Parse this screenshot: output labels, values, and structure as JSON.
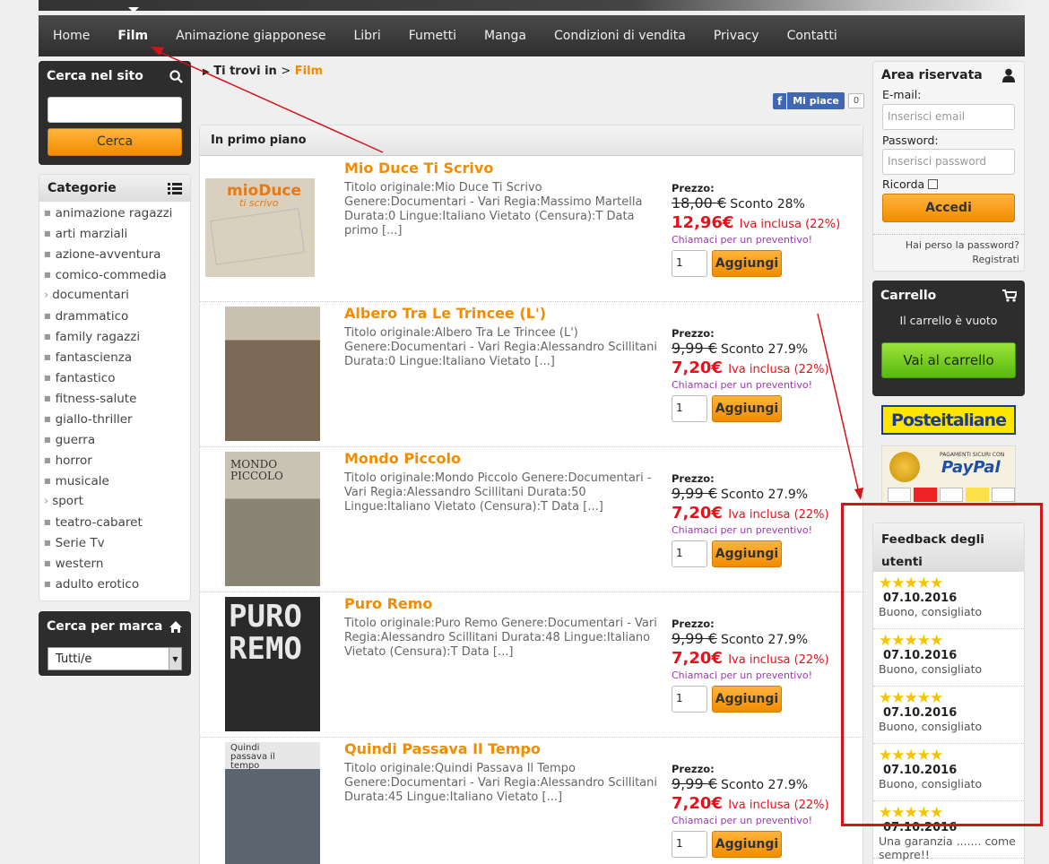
{
  "nav": [
    "Home",
    "Film",
    "Animazione giapponese",
    "Libri",
    "Fumetti",
    "Manga",
    "Condizioni di vendita",
    "Privacy",
    "Contatti"
  ],
  "search": {
    "title": "Cerca nel sito",
    "button": "Cerca"
  },
  "categories": {
    "title": "Categorie",
    "items": [
      "animazione ragazzi",
      "arti marziali",
      "azione-avventura",
      "comico-commedia",
      "documentari",
      "drammatico",
      "family ragazzi",
      "fantascienza",
      "fantastico",
      "fitness-salute",
      "giallo-thriller",
      "guerra",
      "horror",
      "musicale",
      "sport",
      "teatro-cabaret",
      "Serie Tv",
      "western",
      "adulto erotico"
    ]
  },
  "brand": {
    "title": "Cerca per marca",
    "selected": "Tutti/e"
  },
  "breadcrumb": {
    "prefix": "Ti trovi in",
    "sep": ">",
    "current": "Film"
  },
  "facebook": {
    "like": "Mi piace",
    "count": "0"
  },
  "featured_title": "In primo piano",
  "products": [
    {
      "title": "Mio Duce Ti Scrivo",
      "desc": "Titolo originale:Mio Duce Ti Scrivo Genere:Documentari - Vari Regia:Massimo Martella Durata:0 Lingue:Italiano Vietato (Censura):T Data primo [...]",
      "price_label": "Prezzo:",
      "old": "18,00 €",
      "discount": "Sconto 28%",
      "new": "12,96€",
      "iva": "Iva inclusa (22%)",
      "quote": "Chiamaci per un preventivo!",
      "qty": "1",
      "add": "Aggiungi",
      "cover_color": "#d9d1bd"
    },
    {
      "title": "Albero Tra Le Trincee (L')",
      "desc": "Titolo originale:Albero Tra Le Trincee (L') Genere:Documentari - Vari Regia:Alessandro Scillitani Durata:0 Lingue:Italiano Vietato [...]",
      "price_label": "Prezzo:",
      "old": "9,99 €",
      "discount": "Sconto 27.9%",
      "new": "7,20€",
      "iva": "Iva inclusa (22%)",
      "quote": "Chiamaci per un preventivo!",
      "qty": "1",
      "add": "Aggiungi",
      "cover_color": "#7a6a55"
    },
    {
      "title": "Mondo Piccolo",
      "desc": "Titolo originale:Mondo Piccolo Genere:Documentari - Vari Regia:Alessandro Scillitani Durata:50 Lingue:Italiano Vietato (Censura):T Data [...]",
      "price_label": "Prezzo:",
      "old": "9,99 €",
      "discount": "Sconto 27.9%",
      "new": "7,20€",
      "iva": "Iva inclusa (22%)",
      "quote": "Chiamaci per un preventivo!",
      "qty": "1",
      "add": "Aggiungi",
      "cover_color": "#c9c3b3"
    },
    {
      "title": "Puro Remo",
      "desc": "Titolo originale:Puro Remo Genere:Documentari - Vari Regia:Alessandro Scillitani Durata:48 Lingue:Italiano Vietato (Censura):T Data [...]",
      "price_label": "Prezzo:",
      "old": "9,99 €",
      "discount": "Sconto 27.9%",
      "new": "7,20€",
      "iva": "Iva inclusa (22%)",
      "quote": "Chiamaci per un preventivo!",
      "qty": "1",
      "add": "Aggiungi",
      "cover_color": "#2a2a2a"
    },
    {
      "title": "Quindi Passava Il Tempo",
      "desc": "Titolo originale:Quindi Passava Il Tempo Genere:Documentari - Vari Regia:Alessandro Scillitani Durata:45 Lingue:Italiano Vietato [...]",
      "price_label": "Prezzo:",
      "old": "9,99 €",
      "discount": "Sconto 27.9%",
      "new": "7,20€",
      "iva": "Iva inclusa (22%)",
      "quote": "Chiamaci per un preventivo!",
      "qty": "1",
      "add": "Aggiungi",
      "cover_color": "#5c6470"
    }
  ],
  "covers": {
    "mio_duce_title": "mioDuce",
    "mio_duce_sub": "ti scrivo",
    "mondo_title": "MONDO PICCOLO",
    "puro_title": "PURO REMO",
    "quindi_title": "Quindi passava il tempo"
  },
  "login": {
    "title": "Area riservata",
    "email_label": "E-mail:",
    "email_placeholder": "Inserisci email",
    "password_label": "Password:",
    "password_placeholder": "Inserisci password",
    "remember": "Ricorda",
    "button": "Accedi",
    "forgot": "Hai perso la password?",
    "register": "Registrati"
  },
  "cart": {
    "title": "Carrello",
    "empty": "Il carrello è vuoto",
    "button": "Vai al carrello"
  },
  "poste": "Posteitaliane",
  "paypal": {
    "line": "PAGAMENTI SICURI CON",
    "brand": "PayPal"
  },
  "feedback": {
    "title": "Feedback degli utenti",
    "items": [
      {
        "date": "07.10.2016",
        "text": "Buono, consigliato"
      },
      {
        "date": "07.10.2016",
        "text": "Buono, consigliato"
      },
      {
        "date": "07.10.2016",
        "text": "Buono, consigliato"
      },
      {
        "date": "07.10.2016",
        "text": "Buono, consigliato"
      },
      {
        "date": "07.10.2016",
        "text": "Una garanzia ....... come sempre!!"
      }
    ],
    "stars": "★★★★★"
  }
}
